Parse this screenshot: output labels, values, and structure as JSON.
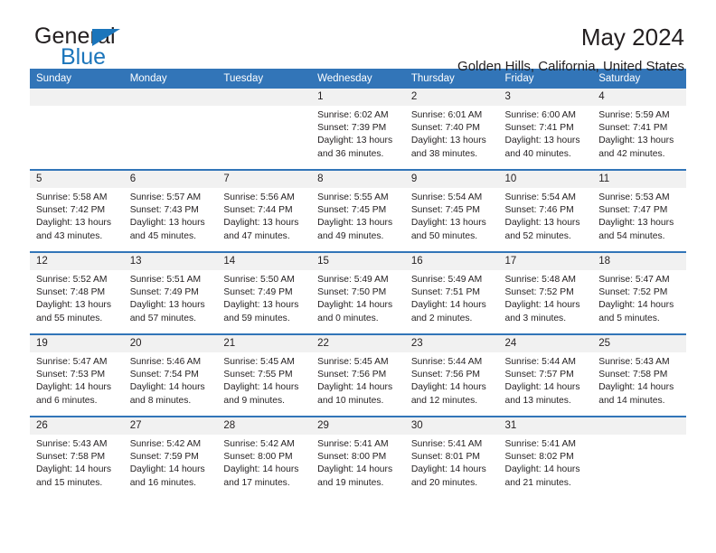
{
  "brand": {
    "name_part1": "General",
    "name_part2": "Blue",
    "accent_color": "#1b75bb"
  },
  "header": {
    "title": "May 2024",
    "subtitle": "Golden Hills, California, United States"
  },
  "theme": {
    "header_bar_color": "#3275b8",
    "day_strip_color": "#f1f1f1"
  },
  "weekdays": [
    "Sunday",
    "Monday",
    "Tuesday",
    "Wednesday",
    "Thursday",
    "Friday",
    "Saturday"
  ],
  "weeks": [
    [
      {
        "day": "",
        "empty": true
      },
      {
        "day": "",
        "empty": true
      },
      {
        "day": "",
        "empty": true
      },
      {
        "day": "1",
        "sunrise": "Sunrise: 6:02 AM",
        "sunset": "Sunset: 7:39 PM",
        "daylight1": "Daylight: 13 hours",
        "daylight2": "and 36 minutes."
      },
      {
        "day": "2",
        "sunrise": "Sunrise: 6:01 AM",
        "sunset": "Sunset: 7:40 PM",
        "daylight1": "Daylight: 13 hours",
        "daylight2": "and 38 minutes."
      },
      {
        "day": "3",
        "sunrise": "Sunrise: 6:00 AM",
        "sunset": "Sunset: 7:41 PM",
        "daylight1": "Daylight: 13 hours",
        "daylight2": "and 40 minutes."
      },
      {
        "day": "4",
        "sunrise": "Sunrise: 5:59 AM",
        "sunset": "Sunset: 7:41 PM",
        "daylight1": "Daylight: 13 hours",
        "daylight2": "and 42 minutes."
      }
    ],
    [
      {
        "day": "5",
        "sunrise": "Sunrise: 5:58 AM",
        "sunset": "Sunset: 7:42 PM",
        "daylight1": "Daylight: 13 hours",
        "daylight2": "and 43 minutes."
      },
      {
        "day": "6",
        "sunrise": "Sunrise: 5:57 AM",
        "sunset": "Sunset: 7:43 PM",
        "daylight1": "Daylight: 13 hours",
        "daylight2": "and 45 minutes."
      },
      {
        "day": "7",
        "sunrise": "Sunrise: 5:56 AM",
        "sunset": "Sunset: 7:44 PM",
        "daylight1": "Daylight: 13 hours",
        "daylight2": "and 47 minutes."
      },
      {
        "day": "8",
        "sunrise": "Sunrise: 5:55 AM",
        "sunset": "Sunset: 7:45 PM",
        "daylight1": "Daylight: 13 hours",
        "daylight2": "and 49 minutes."
      },
      {
        "day": "9",
        "sunrise": "Sunrise: 5:54 AM",
        "sunset": "Sunset: 7:45 PM",
        "daylight1": "Daylight: 13 hours",
        "daylight2": "and 50 minutes."
      },
      {
        "day": "10",
        "sunrise": "Sunrise: 5:54 AM",
        "sunset": "Sunset: 7:46 PM",
        "daylight1": "Daylight: 13 hours",
        "daylight2": "and 52 minutes."
      },
      {
        "day": "11",
        "sunrise": "Sunrise: 5:53 AM",
        "sunset": "Sunset: 7:47 PM",
        "daylight1": "Daylight: 13 hours",
        "daylight2": "and 54 minutes."
      }
    ],
    [
      {
        "day": "12",
        "sunrise": "Sunrise: 5:52 AM",
        "sunset": "Sunset: 7:48 PM",
        "daylight1": "Daylight: 13 hours",
        "daylight2": "and 55 minutes."
      },
      {
        "day": "13",
        "sunrise": "Sunrise: 5:51 AM",
        "sunset": "Sunset: 7:49 PM",
        "daylight1": "Daylight: 13 hours",
        "daylight2": "and 57 minutes."
      },
      {
        "day": "14",
        "sunrise": "Sunrise: 5:50 AM",
        "sunset": "Sunset: 7:49 PM",
        "daylight1": "Daylight: 13 hours",
        "daylight2": "and 59 minutes."
      },
      {
        "day": "15",
        "sunrise": "Sunrise: 5:49 AM",
        "sunset": "Sunset: 7:50 PM",
        "daylight1": "Daylight: 14 hours",
        "daylight2": "and 0 minutes."
      },
      {
        "day": "16",
        "sunrise": "Sunrise: 5:49 AM",
        "sunset": "Sunset: 7:51 PM",
        "daylight1": "Daylight: 14 hours",
        "daylight2": "and 2 minutes."
      },
      {
        "day": "17",
        "sunrise": "Sunrise: 5:48 AM",
        "sunset": "Sunset: 7:52 PM",
        "daylight1": "Daylight: 14 hours",
        "daylight2": "and 3 minutes."
      },
      {
        "day": "18",
        "sunrise": "Sunrise: 5:47 AM",
        "sunset": "Sunset: 7:52 PM",
        "daylight1": "Daylight: 14 hours",
        "daylight2": "and 5 minutes."
      }
    ],
    [
      {
        "day": "19",
        "sunrise": "Sunrise: 5:47 AM",
        "sunset": "Sunset: 7:53 PM",
        "daylight1": "Daylight: 14 hours",
        "daylight2": "and 6 minutes."
      },
      {
        "day": "20",
        "sunrise": "Sunrise: 5:46 AM",
        "sunset": "Sunset: 7:54 PM",
        "daylight1": "Daylight: 14 hours",
        "daylight2": "and 8 minutes."
      },
      {
        "day": "21",
        "sunrise": "Sunrise: 5:45 AM",
        "sunset": "Sunset: 7:55 PM",
        "daylight1": "Daylight: 14 hours",
        "daylight2": "and 9 minutes."
      },
      {
        "day": "22",
        "sunrise": "Sunrise: 5:45 AM",
        "sunset": "Sunset: 7:56 PM",
        "daylight1": "Daylight: 14 hours",
        "daylight2": "and 10 minutes."
      },
      {
        "day": "23",
        "sunrise": "Sunrise: 5:44 AM",
        "sunset": "Sunset: 7:56 PM",
        "daylight1": "Daylight: 14 hours",
        "daylight2": "and 12 minutes."
      },
      {
        "day": "24",
        "sunrise": "Sunrise: 5:44 AM",
        "sunset": "Sunset: 7:57 PM",
        "daylight1": "Daylight: 14 hours",
        "daylight2": "and 13 minutes."
      },
      {
        "day": "25",
        "sunrise": "Sunrise: 5:43 AM",
        "sunset": "Sunset: 7:58 PM",
        "daylight1": "Daylight: 14 hours",
        "daylight2": "and 14 minutes."
      }
    ],
    [
      {
        "day": "26",
        "sunrise": "Sunrise: 5:43 AM",
        "sunset": "Sunset: 7:58 PM",
        "daylight1": "Daylight: 14 hours",
        "daylight2": "and 15 minutes."
      },
      {
        "day": "27",
        "sunrise": "Sunrise: 5:42 AM",
        "sunset": "Sunset: 7:59 PM",
        "daylight1": "Daylight: 14 hours",
        "daylight2": "and 16 minutes."
      },
      {
        "day": "28",
        "sunrise": "Sunrise: 5:42 AM",
        "sunset": "Sunset: 8:00 PM",
        "daylight1": "Daylight: 14 hours",
        "daylight2": "and 17 minutes."
      },
      {
        "day": "29",
        "sunrise": "Sunrise: 5:41 AM",
        "sunset": "Sunset: 8:00 PM",
        "daylight1": "Daylight: 14 hours",
        "daylight2": "and 19 minutes."
      },
      {
        "day": "30",
        "sunrise": "Sunrise: 5:41 AM",
        "sunset": "Sunset: 8:01 PM",
        "daylight1": "Daylight: 14 hours",
        "daylight2": "and 20 minutes."
      },
      {
        "day": "31",
        "sunrise": "Sunrise: 5:41 AM",
        "sunset": "Sunset: 8:02 PM",
        "daylight1": "Daylight: 14 hours",
        "daylight2": "and 21 minutes."
      },
      {
        "day": "",
        "empty": true
      }
    ]
  ]
}
